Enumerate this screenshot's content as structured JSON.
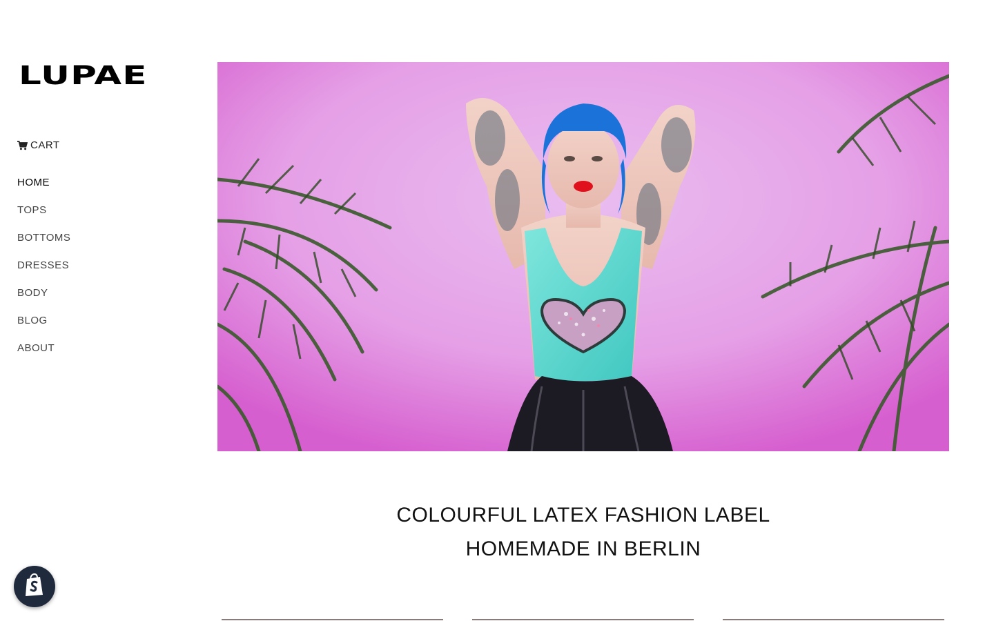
{
  "brand": {
    "logo_text": "LUPAE"
  },
  "sidebar": {
    "cart_label": "CART",
    "cart_icon": "cart-icon",
    "nav": [
      {
        "label": "HOME",
        "active": true
      },
      {
        "label": "TOPS",
        "active": false
      },
      {
        "label": "BOTTOMS",
        "active": false
      },
      {
        "label": "DRESSES",
        "active": false
      },
      {
        "label": "BODY",
        "active": false
      },
      {
        "label": "BLOG",
        "active": false
      },
      {
        "label": "ABOUT",
        "active": false
      }
    ]
  },
  "hero": {
    "image": "hero-photo"
  },
  "tagline": {
    "line1": "COLOURFUL LATEX FASHION LABEL",
    "line2": "HOMEMADE IN BERLIN"
  },
  "shop_badge": {
    "icon": "shopify-bag-icon"
  },
  "colors": {
    "background": "#ffffff",
    "text": "#111111",
    "hero_pink": "#e8a6ea",
    "badge": "#1f2a3c"
  }
}
